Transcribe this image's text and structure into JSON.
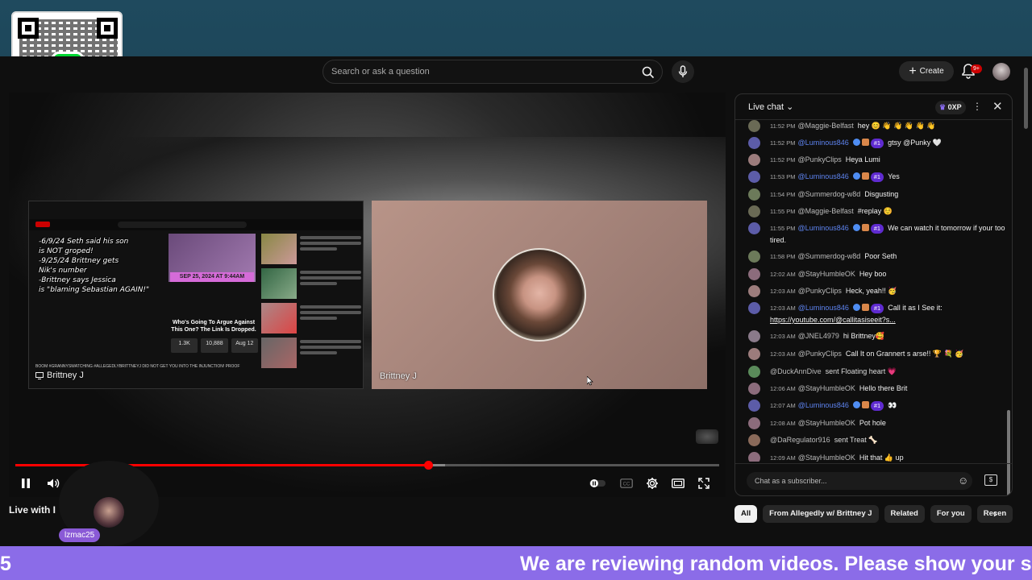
{
  "search": {
    "placeholder": "Search or ask a question"
  },
  "header": {
    "create_label": "Create",
    "notifications_badge": "9+"
  },
  "player": {
    "left_panel": {
      "overlay_lines": "-6/9/24 Seth said his son\nis NOT groped!\n-9/25/24 Brittney gets\nNik's number\n-Brittney says Jessica\nis \"blaming Sebastian AGAIN!\"",
      "date_tag": "SEP 25, 2024 AT 9:44AM",
      "question": "Who's Going To Argue Against This One? The Link Is Dropped.",
      "stats": [
        "1.3K",
        "10,888",
        "Aug 12"
      ],
      "ticker": "BOOM #GRANNYSWATCHING #ALLEGEDLYBRITTNEYJ DID NOT GET YOU INTO THE INJUNCTION! PROOF",
      "label": "Brittney J"
    },
    "right_panel": {
      "label": "Brittney J"
    },
    "progress": 0.587,
    "buffered": 0.61
  },
  "video_title": "Live with I",
  "webcam": {
    "name": "lzmac25"
  },
  "qr": {
    "cash_symbol": "$"
  },
  "chat": {
    "title": "Live chat",
    "xp": "0XP",
    "input_placeholder": "Chat as a subscriber...",
    "messages": [
      {
        "time": "11:52 PM",
        "author": "@Maggie-Belfast",
        "mod": false,
        "rank": "",
        "text": "hey 😊 👋 👋 👋 👋 👋",
        "av": "#6a6a55"
      },
      {
        "time": "11:52 PM",
        "author": "@Luminous846",
        "mod": true,
        "rank": "#1",
        "text": "gtsy @Punky 🤍",
        "av": "#5c5ca8"
      },
      {
        "time": "11:52 PM",
        "author": "@PunkyClips",
        "mod": false,
        "rank": "",
        "text": "Heya Lumi",
        "av": "#9c7c7c"
      },
      {
        "time": "11:53 PM",
        "author": "@Luminous846",
        "mod": true,
        "rank": "#1",
        "text": "Yes",
        "av": "#5c5ca8"
      },
      {
        "time": "11:54 PM",
        "author": "@Summerdog-w8d",
        "mod": false,
        "rank": "",
        "text": "Disgusting",
        "av": "#6c7a5a"
      },
      {
        "time": "11:55 PM",
        "author": "@Maggie-Belfast",
        "mod": false,
        "rank": "",
        "text": "#replay ☺️",
        "av": "#6a6a55"
      },
      {
        "time": "11:55 PM",
        "author": "@Luminous846",
        "mod": true,
        "rank": "#1",
        "text": "We can watch it tomorrow if your too tired.",
        "av": "#5c5ca8"
      },
      {
        "time": "11:58 PM",
        "author": "@Summerdog-w8d",
        "mod": false,
        "rank": "",
        "text": "Poor Seth",
        "av": "#6c7a5a"
      },
      {
        "time": "12:02 AM",
        "author": "@StayHumbleOK",
        "mod": false,
        "rank": "",
        "text": "Hey boo",
        "av": "#8c6c7c"
      },
      {
        "time": "12:03 AM",
        "author": "@PunkyClips",
        "mod": false,
        "rank": "",
        "text": "Heck, yeah!! 🥳",
        "av": "#9c7c7c"
      },
      {
        "time": "12:03 AM",
        "author": "@Luminous846",
        "mod": true,
        "rank": "#1",
        "text": "Call it as I See it: ",
        "link": "https://youtube.com/@callitasiseeit?s...",
        "av": "#5c5ca8"
      },
      {
        "time": "12:03 AM",
        "author": "@JNEL4979",
        "mod": false,
        "rank": "",
        "text": "hi Brittney🥰",
        "av": "#8a7a8a"
      },
      {
        "time": "12:03 AM",
        "author": "@PunkyClips",
        "mod": false,
        "rank": "",
        "text": "Call It on Grannert s arse!! 🏆 💐 🥳",
        "av": "#9c7c7c"
      },
      {
        "time": "",
        "author": "@DuckAnnDive",
        "mod": false,
        "rank": "",
        "system": "sent Floating heart 💗",
        "av": "#5a8a5a"
      },
      {
        "time": "12:06 AM",
        "author": "@StayHumbleOK",
        "mod": false,
        "rank": "",
        "text": "Hello there Brit",
        "av": "#8c6c7c"
      },
      {
        "time": "12:07 AM",
        "author": "@Luminous846",
        "mod": true,
        "rank": "#1",
        "text": "👀",
        "av": "#5c5ca8"
      },
      {
        "time": "12:08 AM",
        "author": "@StayHumbleOK",
        "mod": false,
        "rank": "",
        "text": "Pot hole",
        "av": "#8c6c7c"
      },
      {
        "time": "",
        "author": "@DaRegulator916",
        "mod": false,
        "rank": "",
        "system": "sent Treat 🦴",
        "av": "#8a6a5a"
      },
      {
        "time": "12:09 AM",
        "author": "@StayHumbleOK",
        "mod": false,
        "rank": "",
        "text": "Hit that 👍 up",
        "av": "#8c6c7c"
      }
    ]
  },
  "chips": [
    "All",
    "From Allegedly w/ Brittney J",
    "Related",
    "For you",
    "Recen"
  ],
  "ticker": {
    "left_fragment": "5",
    "text": "We are reviewing random videos. Please show your su"
  }
}
